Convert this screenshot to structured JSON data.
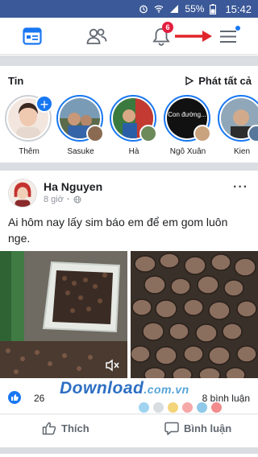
{
  "status_bar": {
    "battery": "55%",
    "time": "15:42"
  },
  "nav": {
    "notification_count": "6"
  },
  "stories": {
    "title": "Tin",
    "play_all": "Phát tất cả",
    "items": [
      {
        "name": "Thêm"
      },
      {
        "name": "Sasuke"
      },
      {
        "name": "Hà"
      },
      {
        "name": "Ngô Xuân",
        "preview_text": "Con đường..."
      },
      {
        "name": "Kien"
      }
    ]
  },
  "post": {
    "author": "Ha Nguyen",
    "time": "8 giờ",
    "text": "Ai hôm nay lấy sim báo em để em gom luôn nge.",
    "like_count": "26",
    "comment_count": "8 bình luận",
    "like_label": "Thích",
    "comment_label": "Bình luận"
  },
  "watermark": {
    "text": "Download",
    "suffix": ".com.vn"
  },
  "colors": {
    "brand": "#3b5998",
    "accent": "#1877f2",
    "badge": "#e41e3f",
    "arrow": "#e0262c"
  },
  "icons": [
    "news-feed-icon",
    "friends-icon",
    "bell-icon",
    "menu-icon",
    "play-icon",
    "globe-icon",
    "mute-icon",
    "like-icon",
    "comment-icon"
  ]
}
